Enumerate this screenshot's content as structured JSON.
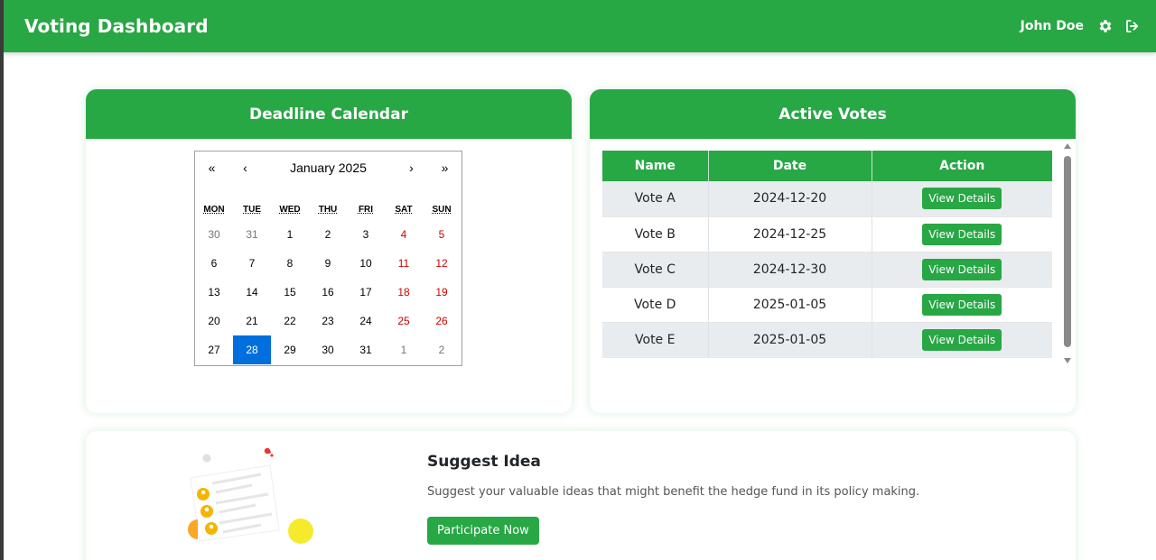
{
  "header": {
    "title": "Voting Dashboard",
    "user_name": "John Doe",
    "settings_icon": "gear-icon",
    "logout_icon": "sign-out-icon",
    "bg_color": "#28a745"
  },
  "calendar": {
    "title": "Deadline Calendar",
    "nav": {
      "prev_year": "«",
      "prev_month": "‹",
      "next_month": "›",
      "next_year": "»"
    },
    "month_label": "January 2025",
    "weekdays": [
      "MON",
      "TUE",
      "WED",
      "THU",
      "FRI",
      "SAT",
      "SUN"
    ],
    "days": [
      {
        "label": "30",
        "other": true,
        "weekend": false
      },
      {
        "label": "31",
        "other": true,
        "weekend": false
      },
      {
        "label": "1",
        "other": false,
        "weekend": false
      },
      {
        "label": "2",
        "other": false,
        "weekend": false
      },
      {
        "label": "3",
        "other": false,
        "weekend": false
      },
      {
        "label": "4",
        "other": false,
        "weekend": true
      },
      {
        "label": "5",
        "other": false,
        "weekend": true
      },
      {
        "label": "6",
        "other": false,
        "weekend": false
      },
      {
        "label": "7",
        "other": false,
        "weekend": false
      },
      {
        "label": "8",
        "other": false,
        "weekend": false
      },
      {
        "label": "9",
        "other": false,
        "weekend": false
      },
      {
        "label": "10",
        "other": false,
        "weekend": false
      },
      {
        "label": "11",
        "other": false,
        "weekend": true
      },
      {
        "label": "12",
        "other": false,
        "weekend": true
      },
      {
        "label": "13",
        "other": false,
        "weekend": false
      },
      {
        "label": "14",
        "other": false,
        "weekend": false
      },
      {
        "label": "15",
        "other": false,
        "weekend": false
      },
      {
        "label": "16",
        "other": false,
        "weekend": false
      },
      {
        "label": "17",
        "other": false,
        "weekend": false
      },
      {
        "label": "18",
        "other": false,
        "weekend": true
      },
      {
        "label": "19",
        "other": false,
        "weekend": true
      },
      {
        "label": "20",
        "other": false,
        "weekend": false
      },
      {
        "label": "21",
        "other": false,
        "weekend": false
      },
      {
        "label": "22",
        "other": false,
        "weekend": false
      },
      {
        "label": "23",
        "other": false,
        "weekend": false
      },
      {
        "label": "24",
        "other": false,
        "weekend": false
      },
      {
        "label": "25",
        "other": false,
        "weekend": true
      },
      {
        "label": "26",
        "other": false,
        "weekend": true
      },
      {
        "label": "27",
        "other": false,
        "weekend": false
      },
      {
        "label": "28",
        "other": false,
        "weekend": false,
        "selected": true
      },
      {
        "label": "29",
        "other": false,
        "weekend": false
      },
      {
        "label": "30",
        "other": false,
        "weekend": false
      },
      {
        "label": "31",
        "other": false,
        "weekend": false
      },
      {
        "label": "1",
        "other": true,
        "weekend": false
      },
      {
        "label": "2",
        "other": true,
        "weekend": false
      }
    ],
    "selected_color": "#006edc",
    "weekend_color": "#d10000"
  },
  "votes": {
    "title": "Active Votes",
    "columns": [
      "Name",
      "Date",
      "Action"
    ],
    "rows": [
      {
        "name": "Vote A",
        "date": "2024-12-20",
        "action": "View Details"
      },
      {
        "name": "Vote B",
        "date": "2024-12-25",
        "action": "View Details"
      },
      {
        "name": "Vote C",
        "date": "2024-12-30",
        "action": "View Details"
      },
      {
        "name": "Vote D",
        "date": "2025-01-05",
        "action": "View Details"
      },
      {
        "name": "Vote E",
        "date": "2025-01-05",
        "action": "View Details"
      }
    ]
  },
  "idea": {
    "title": "Suggest Idea",
    "description": "Suggest your valuable ideas that might benefit the hedge fund in its policy making.",
    "button": "Participate Now",
    "illustration_icon": "idea-list-illustration"
  }
}
